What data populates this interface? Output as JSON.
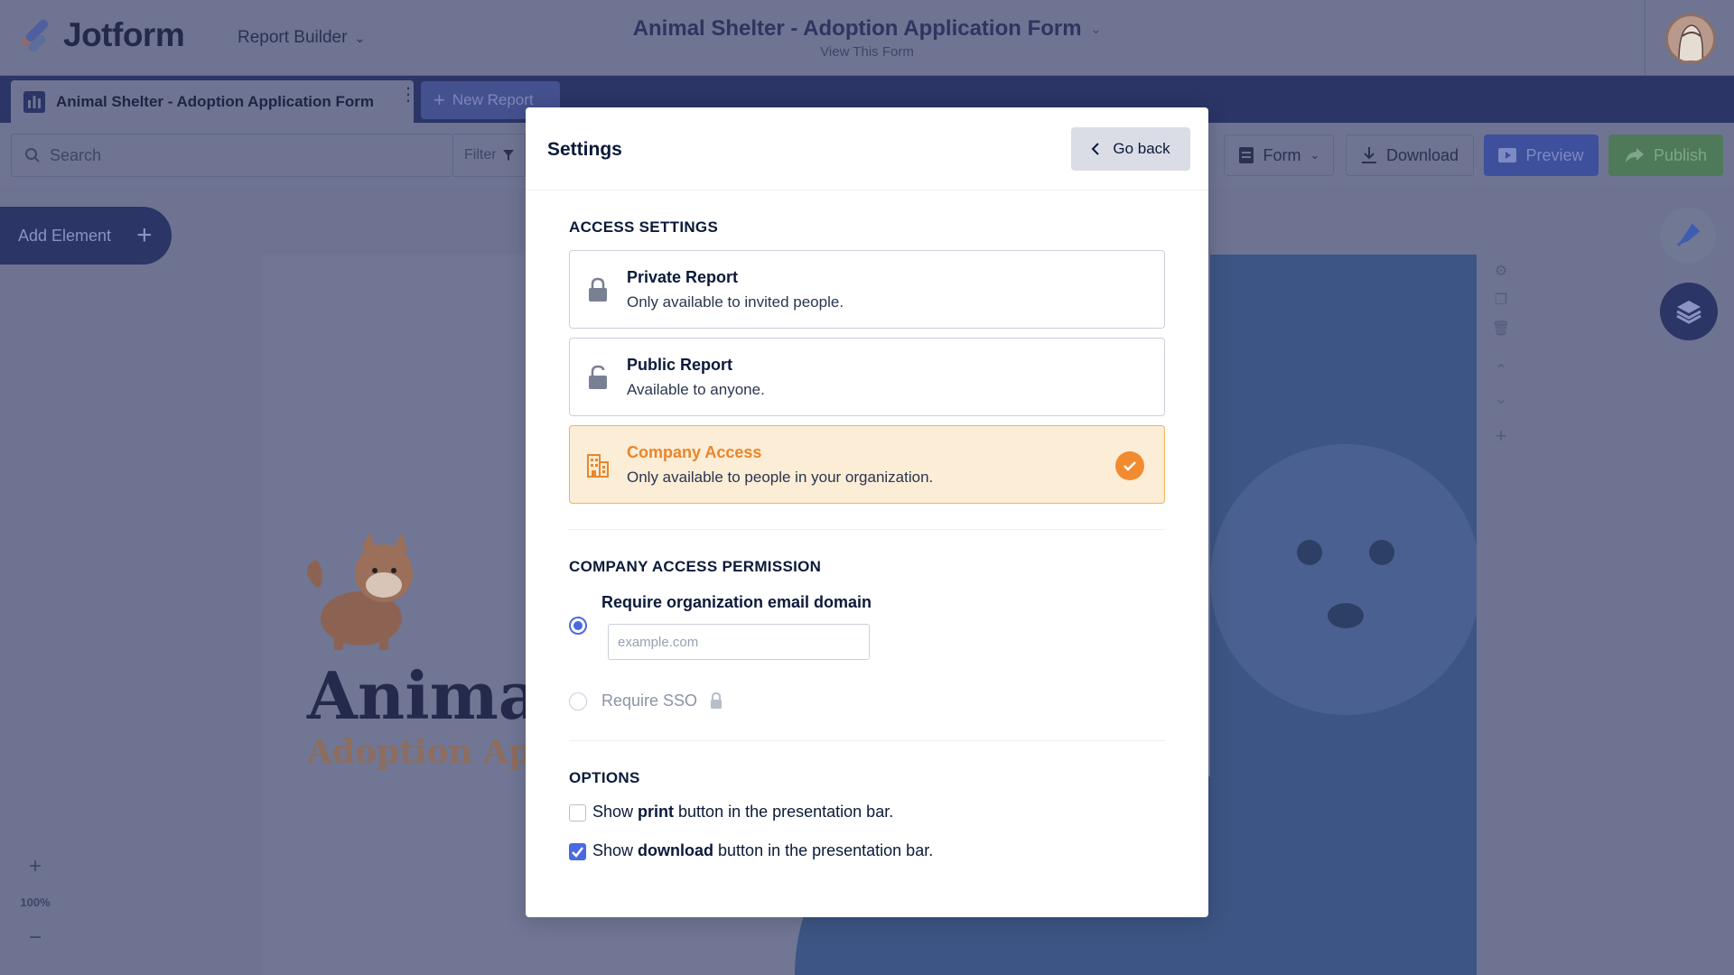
{
  "app": {
    "logo_text": "Jotform",
    "product_menu": "Report Builder",
    "form_title": "Animal Shelter - Adoption Application Form",
    "form_sub": "View This Form"
  },
  "tabs": [
    {
      "label": "Animal Shelter - Adoption Application Form"
    },
    {
      "label": "New Report"
    }
  ],
  "toolbar": {
    "search_placeholder": "Search",
    "filter_label": "Filter",
    "form_label": "Form",
    "download_label": "Download",
    "preview_label": "Preview",
    "publish_label": "Publish"
  },
  "canvas": {
    "add_element_label": "Add Element",
    "heading": "Anima",
    "subheading": "Adoption App",
    "zoom": "100%"
  },
  "modal": {
    "title": "Settings",
    "go_back_label": "Go back",
    "access_settings": {
      "heading": "ACCESS SETTINGS",
      "options": [
        {
          "title": "Private Report",
          "desc": "Only available to invited people.",
          "icon": "lock-icon",
          "selected": false
        },
        {
          "title": "Public Report",
          "desc": "Available to anyone.",
          "icon": "unlock-icon",
          "selected": false
        },
        {
          "title": "Company Access",
          "desc": "Only available to people in your organization.",
          "icon": "building-icon",
          "selected": true
        }
      ]
    },
    "company_permission": {
      "heading": "COMPANY ACCESS PERMISSION",
      "options": [
        {
          "label": "Require organization email domain",
          "selected": true
        },
        {
          "label": "Require SSO",
          "selected": false,
          "locked": true
        }
      ],
      "domain_placeholder": "example.com"
    },
    "options": {
      "heading": "OPTIONS",
      "print": {
        "pre": "Show ",
        "bold": "print",
        "post": " button in the presentation bar.",
        "checked": false
      },
      "download": {
        "pre": "Show ",
        "bold": "download",
        "post": " button in the presentation bar.",
        "checked": true
      }
    }
  },
  "colors": {
    "accent_blue": "#4a6ae0",
    "selected_orange": "#f28b2f",
    "navy": "#2b3566"
  }
}
